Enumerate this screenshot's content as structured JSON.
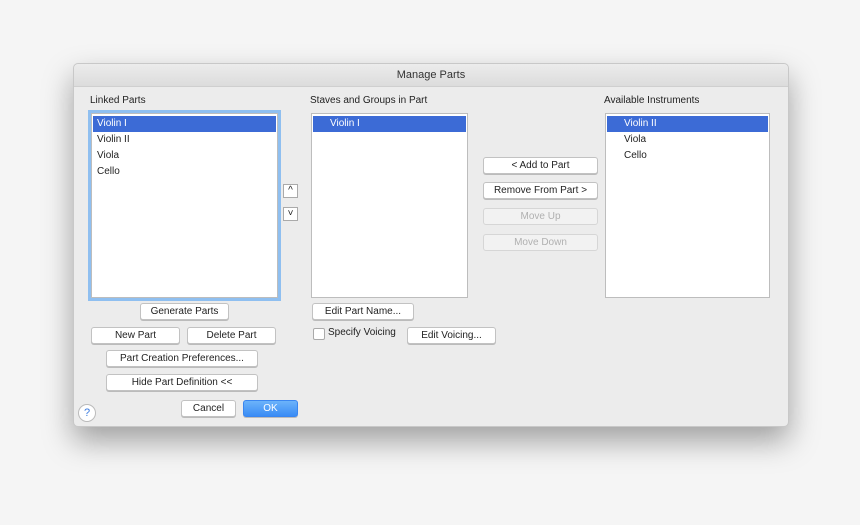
{
  "window": {
    "title": "Manage Parts"
  },
  "linked_parts": {
    "label": "Linked Parts",
    "items": [
      "Violin I",
      "Violin II",
      "Viola",
      "Cello"
    ],
    "selected": 0
  },
  "staves": {
    "label": "Staves and Groups in Part",
    "items": [
      "Violin I"
    ],
    "selected": 0
  },
  "available": {
    "label": "Available Instruments",
    "items": [
      "Violin II",
      "Viola",
      "Cello"
    ],
    "selected": 0
  },
  "buttons": {
    "add_to_part": "< Add to Part",
    "remove_from_part": "Remove From Part >",
    "move_up": "Move Up",
    "move_down": "Move Down",
    "generate_parts": "Generate Parts",
    "new_part": "New Part",
    "delete_part": "Delete Part",
    "part_creation_prefs": "Part Creation Preferences...",
    "hide_part_definition": "Hide Part Definition <<",
    "cancel": "Cancel",
    "ok": "OK",
    "edit_part_name": "Edit Part Name...",
    "edit_voicing": "Edit Voicing..."
  },
  "button_states": {
    "move_up": "disabled",
    "move_down": "disabled",
    "ok": "default"
  },
  "specify_voicing": {
    "label": "Specify Voicing",
    "checked": false
  },
  "icons": {
    "up": "^",
    "down": "˅",
    "help": "?"
  }
}
